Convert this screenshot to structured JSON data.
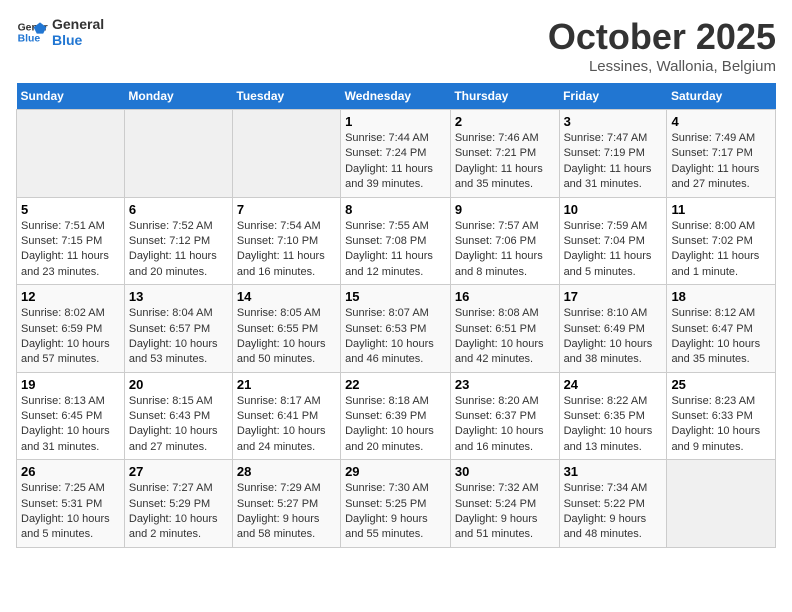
{
  "header": {
    "logo_line1": "General",
    "logo_line2": "Blue",
    "month": "October 2025",
    "location": "Lessines, Wallonia, Belgium"
  },
  "days_of_week": [
    "Sunday",
    "Monday",
    "Tuesday",
    "Wednesday",
    "Thursday",
    "Friday",
    "Saturday"
  ],
  "weeks": [
    [
      {
        "day": "",
        "info": ""
      },
      {
        "day": "",
        "info": ""
      },
      {
        "day": "",
        "info": ""
      },
      {
        "day": "1",
        "info": "Sunrise: 7:44 AM\nSunset: 7:24 PM\nDaylight: 11 hours\nand 39 minutes."
      },
      {
        "day": "2",
        "info": "Sunrise: 7:46 AM\nSunset: 7:21 PM\nDaylight: 11 hours\nand 35 minutes."
      },
      {
        "day": "3",
        "info": "Sunrise: 7:47 AM\nSunset: 7:19 PM\nDaylight: 11 hours\nand 31 minutes."
      },
      {
        "day": "4",
        "info": "Sunrise: 7:49 AM\nSunset: 7:17 PM\nDaylight: 11 hours\nand 27 minutes."
      }
    ],
    [
      {
        "day": "5",
        "info": "Sunrise: 7:51 AM\nSunset: 7:15 PM\nDaylight: 11 hours\nand 23 minutes."
      },
      {
        "day": "6",
        "info": "Sunrise: 7:52 AM\nSunset: 7:12 PM\nDaylight: 11 hours\nand 20 minutes."
      },
      {
        "day": "7",
        "info": "Sunrise: 7:54 AM\nSunset: 7:10 PM\nDaylight: 11 hours\nand 16 minutes."
      },
      {
        "day": "8",
        "info": "Sunrise: 7:55 AM\nSunset: 7:08 PM\nDaylight: 11 hours\nand 12 minutes."
      },
      {
        "day": "9",
        "info": "Sunrise: 7:57 AM\nSunset: 7:06 PM\nDaylight: 11 hours\nand 8 minutes."
      },
      {
        "day": "10",
        "info": "Sunrise: 7:59 AM\nSunset: 7:04 PM\nDaylight: 11 hours\nand 5 minutes."
      },
      {
        "day": "11",
        "info": "Sunrise: 8:00 AM\nSunset: 7:02 PM\nDaylight: 11 hours\nand 1 minute."
      }
    ],
    [
      {
        "day": "12",
        "info": "Sunrise: 8:02 AM\nSunset: 6:59 PM\nDaylight: 10 hours\nand 57 minutes."
      },
      {
        "day": "13",
        "info": "Sunrise: 8:04 AM\nSunset: 6:57 PM\nDaylight: 10 hours\nand 53 minutes."
      },
      {
        "day": "14",
        "info": "Sunrise: 8:05 AM\nSunset: 6:55 PM\nDaylight: 10 hours\nand 50 minutes."
      },
      {
        "day": "15",
        "info": "Sunrise: 8:07 AM\nSunset: 6:53 PM\nDaylight: 10 hours\nand 46 minutes."
      },
      {
        "day": "16",
        "info": "Sunrise: 8:08 AM\nSunset: 6:51 PM\nDaylight: 10 hours\nand 42 minutes."
      },
      {
        "day": "17",
        "info": "Sunrise: 8:10 AM\nSunset: 6:49 PM\nDaylight: 10 hours\nand 38 minutes."
      },
      {
        "day": "18",
        "info": "Sunrise: 8:12 AM\nSunset: 6:47 PM\nDaylight: 10 hours\nand 35 minutes."
      }
    ],
    [
      {
        "day": "19",
        "info": "Sunrise: 8:13 AM\nSunset: 6:45 PM\nDaylight: 10 hours\nand 31 minutes."
      },
      {
        "day": "20",
        "info": "Sunrise: 8:15 AM\nSunset: 6:43 PM\nDaylight: 10 hours\nand 27 minutes."
      },
      {
        "day": "21",
        "info": "Sunrise: 8:17 AM\nSunset: 6:41 PM\nDaylight: 10 hours\nand 24 minutes."
      },
      {
        "day": "22",
        "info": "Sunrise: 8:18 AM\nSunset: 6:39 PM\nDaylight: 10 hours\nand 20 minutes."
      },
      {
        "day": "23",
        "info": "Sunrise: 8:20 AM\nSunset: 6:37 PM\nDaylight: 10 hours\nand 16 minutes."
      },
      {
        "day": "24",
        "info": "Sunrise: 8:22 AM\nSunset: 6:35 PM\nDaylight: 10 hours\nand 13 minutes."
      },
      {
        "day": "25",
        "info": "Sunrise: 8:23 AM\nSunset: 6:33 PM\nDaylight: 10 hours\nand 9 minutes."
      }
    ],
    [
      {
        "day": "26",
        "info": "Sunrise: 7:25 AM\nSunset: 5:31 PM\nDaylight: 10 hours\nand 5 minutes."
      },
      {
        "day": "27",
        "info": "Sunrise: 7:27 AM\nSunset: 5:29 PM\nDaylight: 10 hours\nand 2 minutes."
      },
      {
        "day": "28",
        "info": "Sunrise: 7:29 AM\nSunset: 5:27 PM\nDaylight: 9 hours\nand 58 minutes."
      },
      {
        "day": "29",
        "info": "Sunrise: 7:30 AM\nSunset: 5:25 PM\nDaylight: 9 hours\nand 55 minutes."
      },
      {
        "day": "30",
        "info": "Sunrise: 7:32 AM\nSunset: 5:24 PM\nDaylight: 9 hours\nand 51 minutes."
      },
      {
        "day": "31",
        "info": "Sunrise: 7:34 AM\nSunset: 5:22 PM\nDaylight: 9 hours\nand 48 minutes."
      },
      {
        "day": "",
        "info": ""
      }
    ]
  ]
}
